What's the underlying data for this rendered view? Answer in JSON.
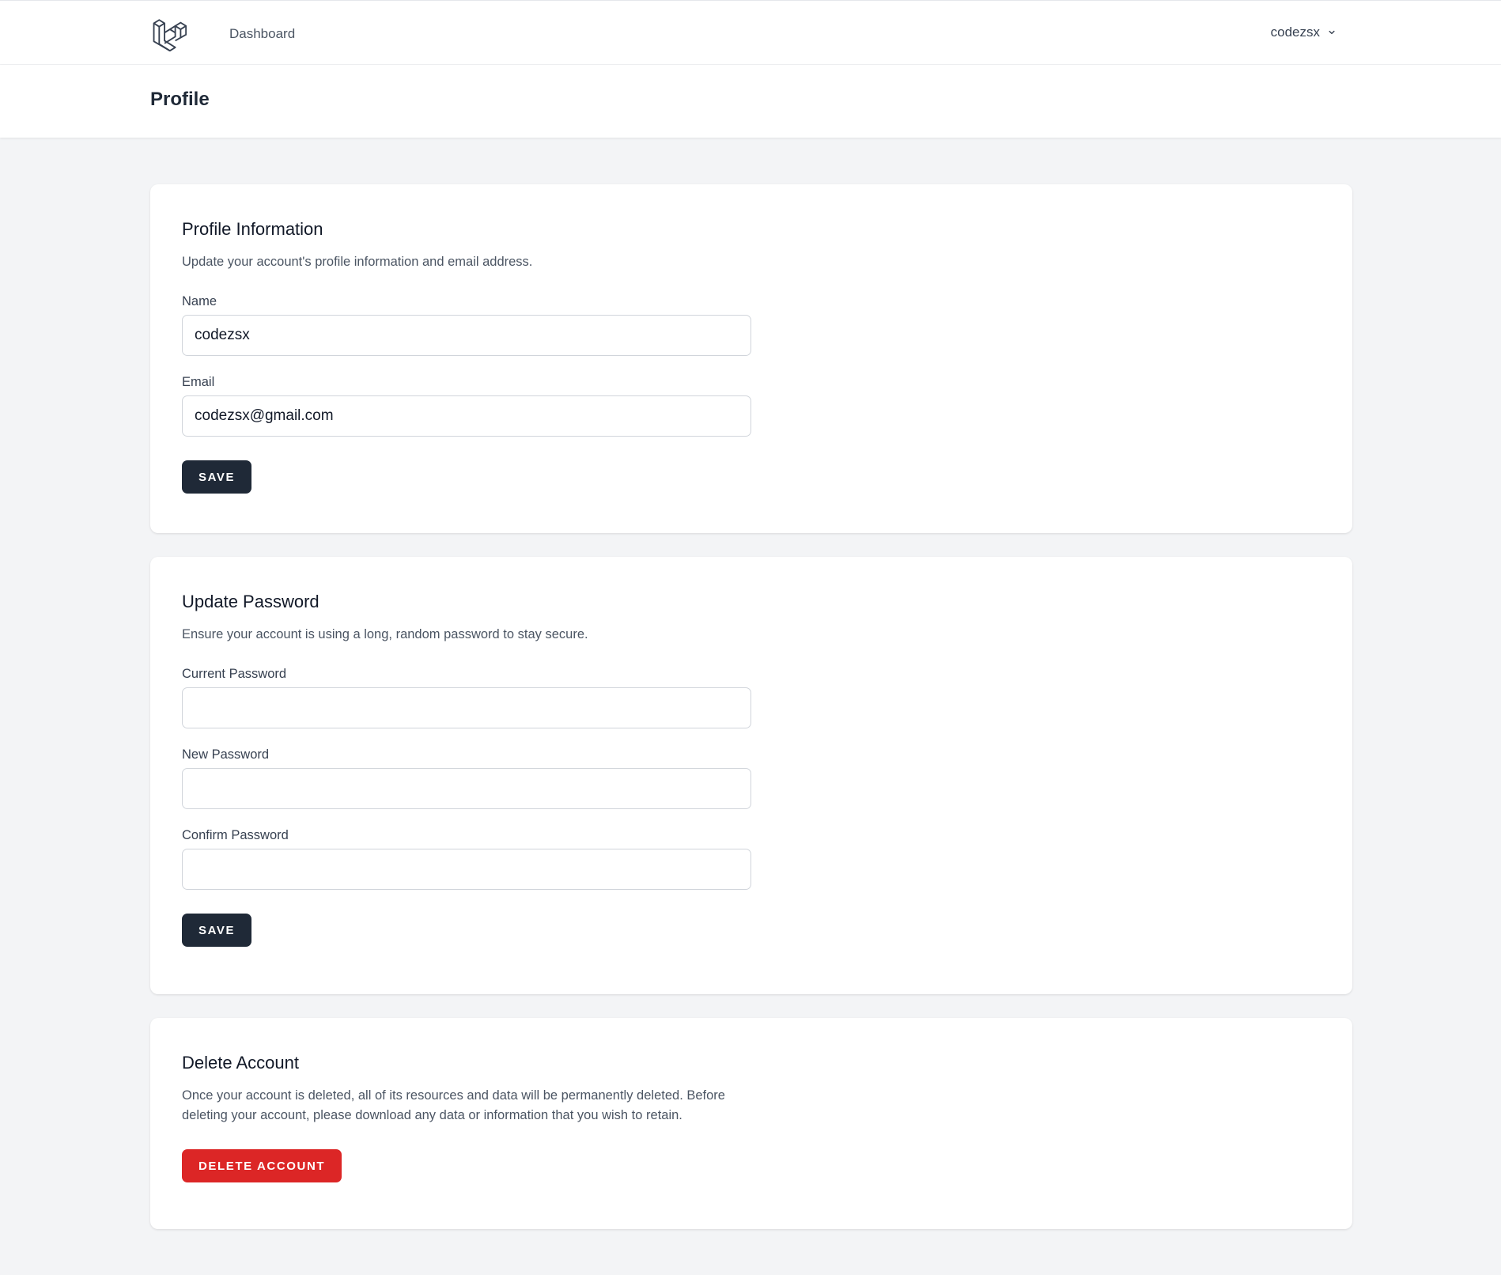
{
  "nav": {
    "dashboard_label": "Dashboard",
    "user_name": "codezsx"
  },
  "header": {
    "title": "Profile"
  },
  "profile_info": {
    "title": "Profile Information",
    "description": "Update your account's profile information and email address.",
    "name_label": "Name",
    "name_value": "codezsx",
    "email_label": "Email",
    "email_value": "codezsx@gmail.com",
    "save_label": "SAVE"
  },
  "update_password": {
    "title": "Update Password",
    "description": "Ensure your account is using a long, random password to stay secure.",
    "current_label": "Current Password",
    "current_value": "",
    "new_label": "New Password",
    "new_value": "",
    "confirm_label": "Confirm Password",
    "confirm_value": "",
    "save_label": "SAVE"
  },
  "delete_account": {
    "title": "Delete Account",
    "description": "Once your account is deleted, all of its resources and data will be permanently deleted. Before deleting your account, please download any data or information that you wish to retain.",
    "delete_label": "DELETE ACCOUNT"
  },
  "colors": {
    "primary_button": "#1f2937",
    "danger_button": "#dc2626",
    "background": "#f3f4f6"
  },
  "icons": {
    "logo": "laravel-logo-icon",
    "user_menu_caret": "chevron-down-icon"
  }
}
